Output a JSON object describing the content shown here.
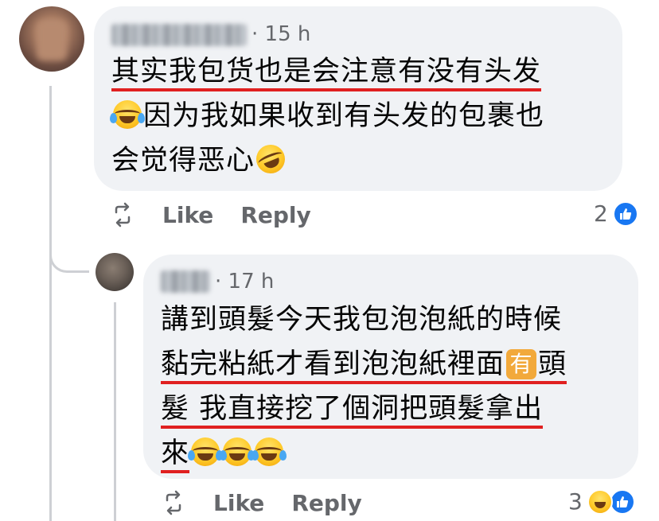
{
  "comments": [
    {
      "timestamp": "15 h",
      "lines": [
        [
          "其实我包货也是会注意有没有头发"
        ],
        [
          "😂",
          "因为我如果收到有头发的包裹也"
        ],
        [
          "会觉得恶心",
          "🤣"
        ]
      ],
      "actions": {
        "like": "Like",
        "reply": "Reply"
      },
      "reaction_count": "2",
      "share_icon": "share-refresh-icon"
    },
    {
      "timestamp": "17 h",
      "lines": [
        [
          "講到頭髮今天我包泡泡紙的時候"
        ],
        [
          "黏完粘紙才看到泡泡紙裡面",
          "有",
          "頭"
        ],
        [
          "髮 我直接挖了個洞把頭髮拿出"
        ],
        [
          "來",
          "😂😂😂"
        ]
      ],
      "actions": {
        "like": "Like",
        "reply": "Reply"
      },
      "reaction_count": "3",
      "share_icon": "share-refresh-icon"
    }
  ],
  "colors": {
    "bubble": "#f0f2f5",
    "text": "#050505",
    "muted": "#65676b",
    "underline": "#e02020",
    "like_blue": "#1877f2",
    "thread_line": "#ced0d4"
  }
}
